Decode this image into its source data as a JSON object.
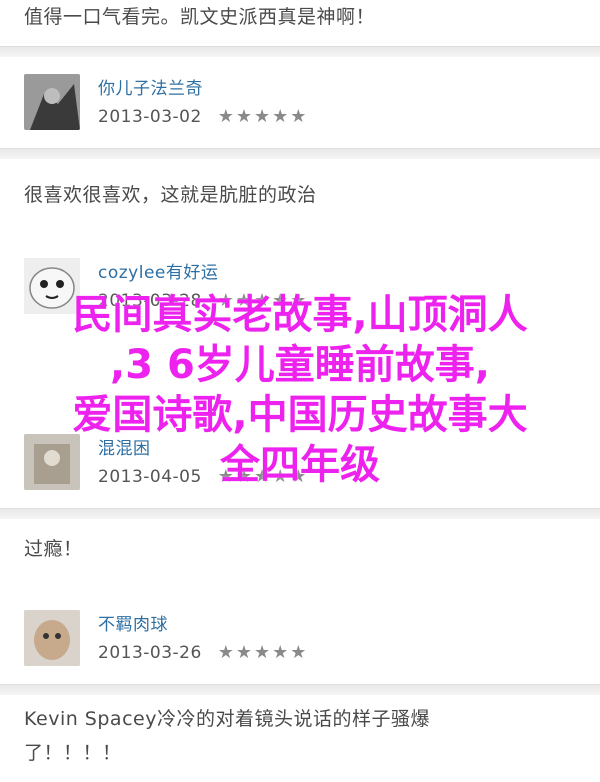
{
  "comments": [
    {
      "text": "值得一口气看完。凯文史派西真是神啊！",
      "user": "你儿子法兰奇",
      "date": "2013-03-02",
      "stars": "★★★★★"
    },
    {
      "text": "很喜欢很喜欢，这就是肮脏的政治",
      "user": "cozylee有好运",
      "date": "2013-03-28",
      "stars": "★★★★★"
    },
    {
      "text": "",
      "user": "混混困",
      "date": "2013-04-05",
      "stars": "★★★★★"
    },
    {
      "text": "过瘾！",
      "user": "不羁肉球",
      "date": "2013-03-26",
      "stars": "★★★★★"
    },
    {
      "text": "Kevin Spacey冷冷的对着镜头说话的样子骚爆",
      "text2": "了！！！！"
    }
  ],
  "overlay": {
    "line1": "民间真实老故事,山顶洞人",
    "line2": ",3 6岁儿童睡前故事,",
    "line3": "爱国诗歌,中国历史故事大",
    "line4": "全四年级"
  },
  "colors": {
    "username": "#2e6fa3",
    "overlay": "#ee22ee",
    "separator": "#e9e9e9"
  }
}
